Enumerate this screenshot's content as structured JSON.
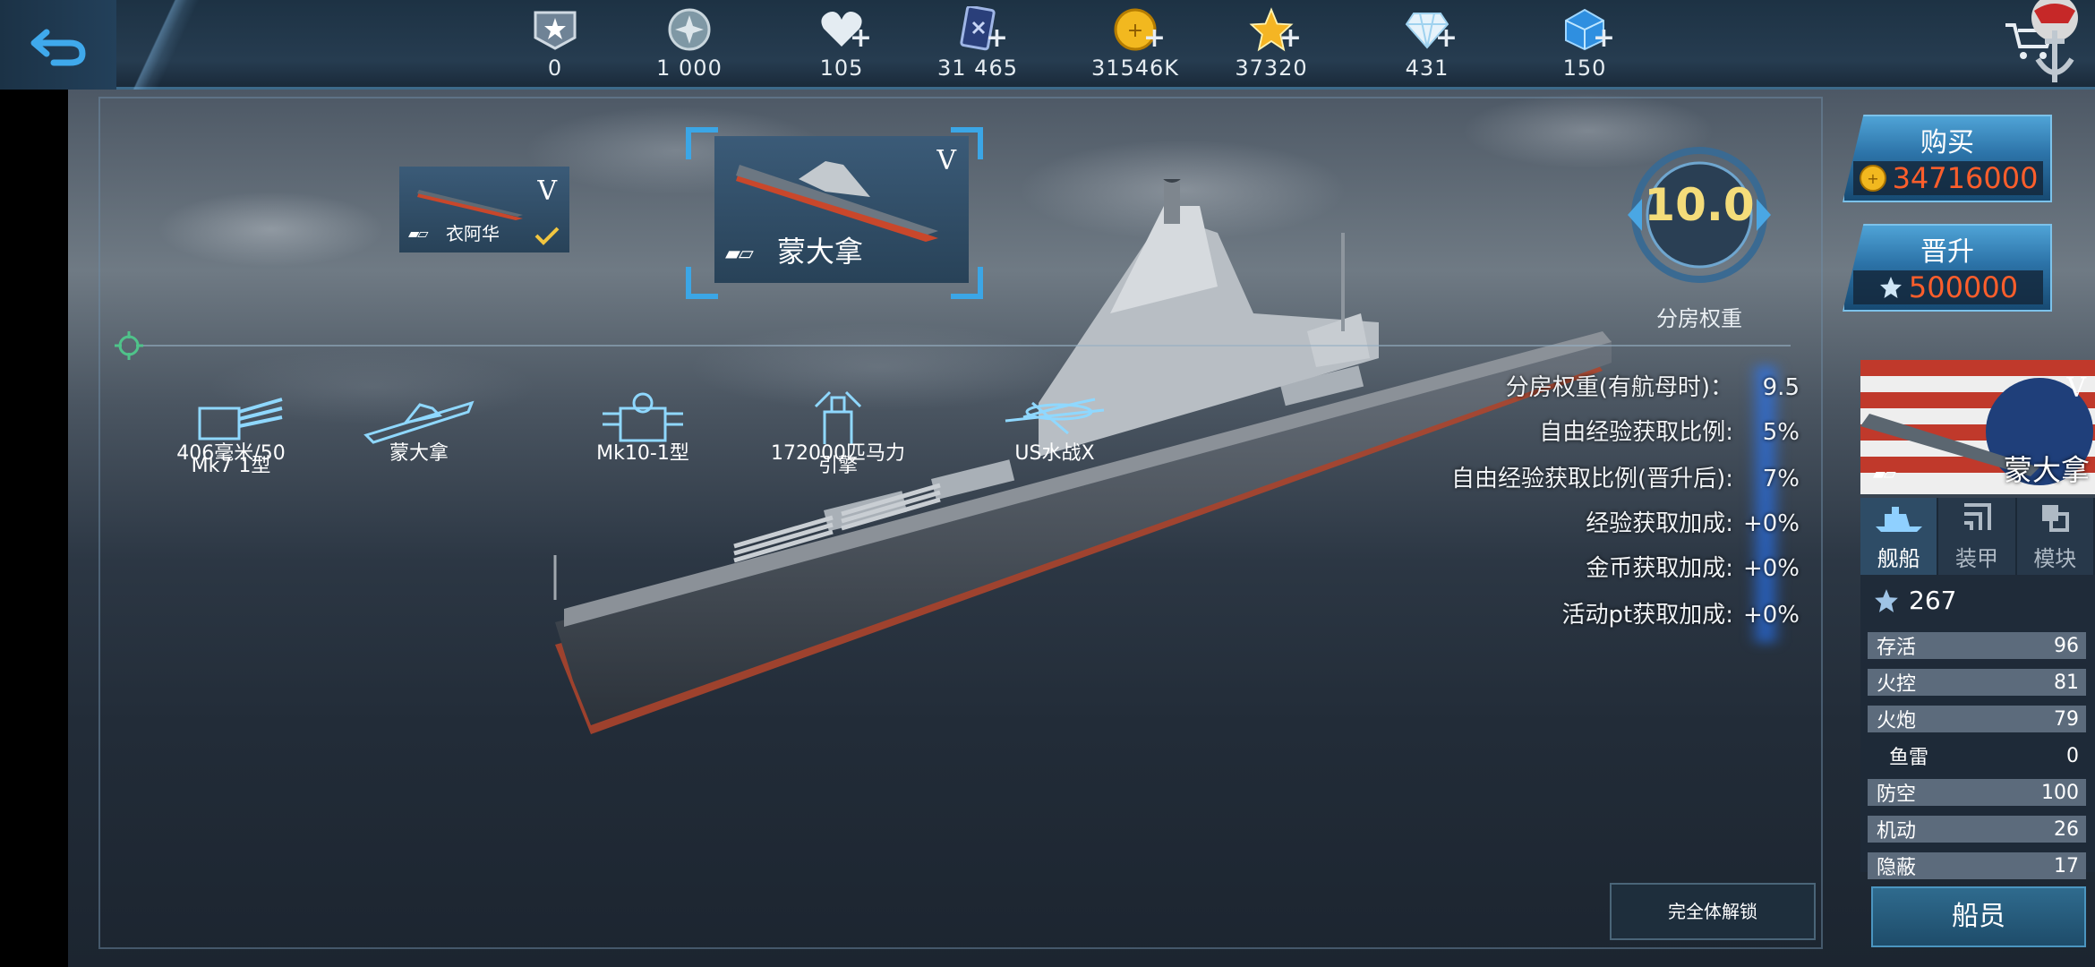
{
  "resources": [
    {
      "icon": "rank-badge-icon",
      "value": "0",
      "plus": false
    },
    {
      "icon": "silver-coin-icon",
      "value": "1 000",
      "plus": false
    },
    {
      "icon": "heart-icon",
      "value": "105",
      "plus": true
    },
    {
      "icon": "card-icon",
      "value": "31 465",
      "plus": true
    },
    {
      "icon": "gold-coin-icon",
      "value": "31546K",
      "plus": true
    },
    {
      "icon": "gold-star-icon",
      "value": "37320",
      "plus": true
    },
    {
      "icon": "diamond-icon",
      "value": "431",
      "plus": true
    },
    {
      "icon": "blue-cube-icon",
      "value": "150",
      "plus": true
    }
  ],
  "plus_sign": "+",
  "ships": {
    "previous": {
      "name": "衣阿华",
      "tier": "V",
      "class_mark": "▰▱"
    },
    "current": {
      "name": "蒙大拿",
      "tier": "V",
      "class_mark": "▰▱"
    }
  },
  "modules": [
    {
      "icon": "main-gun-icon",
      "label_line1": "406毫米/50",
      "label_line2": "Mk7 1型"
    },
    {
      "icon": "hull-icon",
      "label_line1": "蒙大拿",
      "label_line2": ""
    },
    {
      "icon": "fire-control-icon",
      "label_line1": "Mk10-1型",
      "label_line2": ""
    },
    {
      "icon": "engine-icon",
      "label_line1": "172000匹马力",
      "label_line2": "引擎"
    },
    {
      "icon": "seaplane-icon",
      "label_line1": "US水战X",
      "label_line2": ""
    }
  ],
  "rating": {
    "value": "10.0",
    "label": "分房权重"
  },
  "stats": [
    {
      "label": "分房权重(有航母时)：",
      "value": "9.5"
    },
    {
      "label": "自由经验获取比例:",
      "value": "5%"
    },
    {
      "label": "自由经验获取比例(晋升后):",
      "value": "7%"
    },
    {
      "label": "经验获取加成:",
      "value": "+0%"
    },
    {
      "label": "金币获取加成:",
      "value": "+0%"
    },
    {
      "label": "活动pt获取加成:",
      "value": "+0%"
    }
  ],
  "buy": {
    "label": "购买",
    "price": "34716000"
  },
  "promote": {
    "label": "晋升",
    "price": "500000"
  },
  "side_card": {
    "name": "蒙大拿",
    "tier": "V",
    "class_mark": "▰▱"
  },
  "tabs": [
    {
      "label": "舰船",
      "active": true
    },
    {
      "label": "装甲",
      "active": false
    },
    {
      "label": "模块",
      "active": false
    }
  ],
  "level": "267",
  "attributes": [
    {
      "name": "存活",
      "value": "96",
      "highlight": true
    },
    {
      "name": "火控",
      "value": "81",
      "highlight": true
    },
    {
      "name": "火炮",
      "value": "79",
      "highlight": true
    },
    {
      "name": "鱼雷",
      "value": "0",
      "highlight": false
    },
    {
      "name": "防空",
      "value": "100",
      "highlight": true
    },
    {
      "name": "机动",
      "value": "26",
      "highlight": true
    },
    {
      "name": "隐蔽",
      "value": "17",
      "highlight": true
    }
  ],
  "crew_button": "船员",
  "unlock_button": "完全体解锁",
  "colors": {
    "accent_blue": "#3ba6e6",
    "price_orange": "#ff5e2b",
    "rating_gold": "#f4dc7a"
  }
}
